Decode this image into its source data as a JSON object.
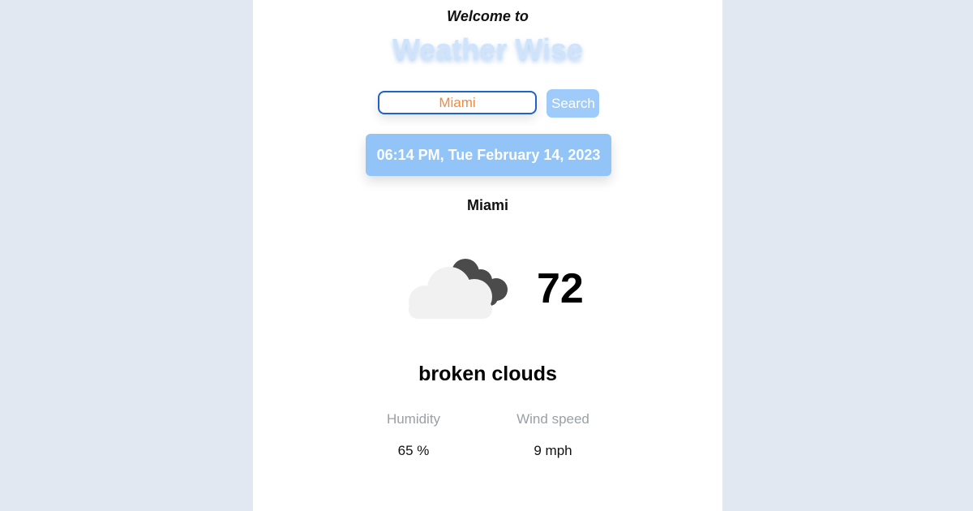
{
  "header": {
    "welcome": "Welcome to",
    "brand": "Weather Wise"
  },
  "search": {
    "value": "Miami",
    "button_label": "Search"
  },
  "datetime": "06:14 PM, Tue February 14, 2023",
  "location": "Miami",
  "weather": {
    "icon": "broken-clouds-icon",
    "temperature": "72",
    "description": "broken clouds"
  },
  "stats": {
    "humidity": {
      "label": "Humidity",
      "value": "65 %"
    },
    "wind": {
      "label": "Wind speed",
      "value": "9 mph"
    }
  },
  "colors": {
    "page_bg": "#e1e8f1",
    "accent": "#92c4f8",
    "input_border": "#1f63c6",
    "input_text": "#f18a3e"
  }
}
